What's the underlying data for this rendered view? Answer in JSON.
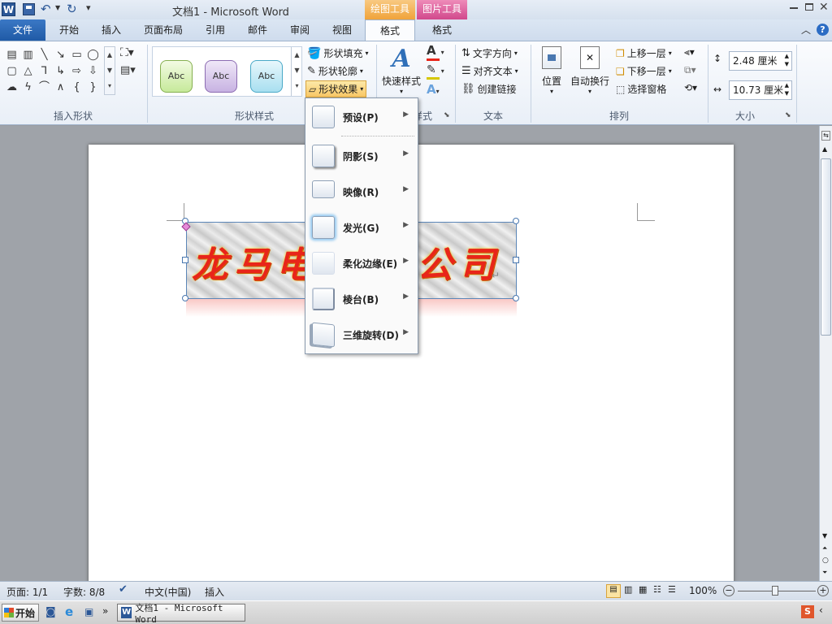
{
  "titlebar": {
    "title": "文档1 - Microsoft Word",
    "qat_more": "▾"
  },
  "context_tabs": {
    "drawing_tools": "绘图工具",
    "picture_tools": "图片工具"
  },
  "tabs": {
    "file": "文件",
    "home": "开始",
    "insert": "插入",
    "layout": "页面布局",
    "references": "引用",
    "mailings": "邮件",
    "review": "审阅",
    "view": "视图",
    "format1": "格式",
    "format2": "格式"
  },
  "ribbon": {
    "groups": {
      "insert_shapes": "插入形状",
      "shape_styles": "形状样式",
      "art_styles": "样式",
      "text": "文本",
      "arrange": "排列",
      "size": "大小"
    },
    "styles": {
      "abc": "Abc"
    },
    "shape_fill": "形状填充",
    "shape_outline": "形状轮廓",
    "shape_effects": "形状效果",
    "quick_styles": "快速样式",
    "text_direction": "文字方向",
    "align_text": "对齐文本",
    "create_link": "创建链接",
    "position": "位置",
    "wrap_text": "自动换行",
    "bring_forward": "上移一层",
    "send_backward": "下移一层",
    "selection_pane": "选择窗格",
    "height": "2.48 厘米",
    "width": "10.73 厘米"
  },
  "menu": {
    "items": [
      {
        "label": "预设(P)"
      },
      {
        "label": "阴影(S)"
      },
      {
        "label": "映像(R)"
      },
      {
        "label": "发光(G)"
      },
      {
        "label": "柔化边缘(E)"
      },
      {
        "label": "棱台(B)"
      },
      {
        "label": "三维旋转(D)"
      }
    ]
  },
  "document": {
    "wordart_left": "龙马电",
    "wordart_right": "公司",
    "para_mark": "↵"
  },
  "statusbar": {
    "page": "页面: 1/1",
    "words": "字数: 8/8",
    "language": "中文(中国)",
    "insert_mode": "插入",
    "zoom": "100%"
  },
  "taskbar": {
    "start": "开始",
    "more": "»",
    "app": "文档1 - Microsoft Word"
  },
  "colors": {
    "accent_blue": "#2b5797",
    "drawing_tools": "#f0a33a",
    "picture_tools": "#d1488c",
    "wordart": "#e8251a"
  }
}
